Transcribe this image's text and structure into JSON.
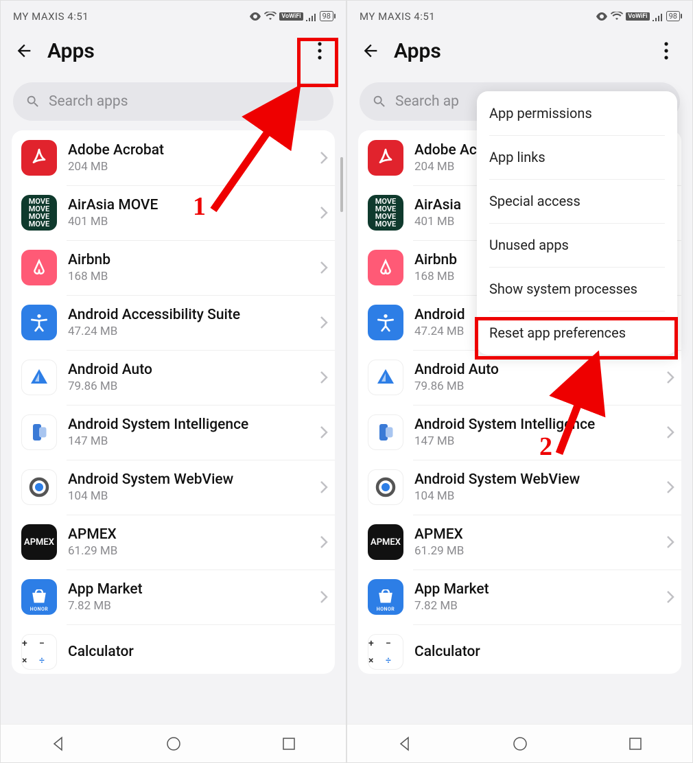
{
  "status": {
    "carrier": "MY MAXIS",
    "time": "4:51",
    "vowifi": "VoWiFi",
    "battery": "98"
  },
  "header": {
    "title": "Apps"
  },
  "search": {
    "placeholder": "Search apps"
  },
  "apps": [
    {
      "name": "Adobe Acrobat",
      "size": "204 MB"
    },
    {
      "name": "AirAsia MOVE",
      "size": "401 MB"
    },
    {
      "name": "Airbnb",
      "size": "168 MB"
    },
    {
      "name": "Android Accessibility Suite",
      "size": "47.24 MB"
    },
    {
      "name": "Android Auto",
      "size": "79.86 MB"
    },
    {
      "name": "Android System Intelligence",
      "size": "147 MB"
    },
    {
      "name": "Android System WebView",
      "size": "104 MB"
    },
    {
      "name": "APMEX",
      "size": "61.29 MB"
    },
    {
      "name": "App Market",
      "size": "7.82 MB"
    },
    {
      "name": "Calculator",
      "size": ""
    }
  ],
  "menu": {
    "items": [
      "App permissions",
      "App links",
      "Special access",
      "Unused apps",
      "Show system processes",
      "Reset app preferences"
    ]
  },
  "annotations": {
    "step1": "1",
    "step2": "2"
  },
  "right_search_visible": "Search ap",
  "right_app_names_trunc": {
    "airasia": "AirAsia",
    "airbnb": "Airbnb",
    "access": "Android"
  }
}
